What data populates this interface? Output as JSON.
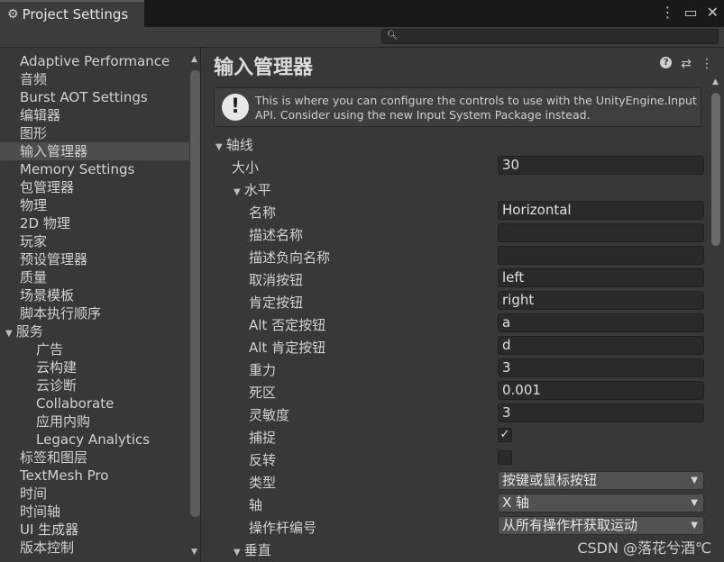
{
  "window": {
    "tab_title": "Project Settings",
    "tab_icon": "gear-icon",
    "controls": [
      "kebab-menu-icon",
      "maximize-icon",
      "close-icon"
    ]
  },
  "search": {
    "value": "",
    "icon": "search-icon"
  },
  "sidebar": {
    "items": [
      {
        "label": "Adaptive Performance",
        "depth": 0
      },
      {
        "label": "音频",
        "depth": 0
      },
      {
        "label": "Burst AOT Settings",
        "depth": 0
      },
      {
        "label": "编辑器",
        "depth": 0
      },
      {
        "label": "图形",
        "depth": 0
      },
      {
        "label": "输入管理器",
        "depth": 0,
        "selected": true
      },
      {
        "label": "Memory Settings",
        "depth": 0
      },
      {
        "label": "包管理器",
        "depth": 0
      },
      {
        "label": "物理",
        "depth": 0
      },
      {
        "label": "2D 物理",
        "depth": 0
      },
      {
        "label": "玩家",
        "depth": 0
      },
      {
        "label": "预设管理器",
        "depth": 0
      },
      {
        "label": "质量",
        "depth": 0
      },
      {
        "label": "场景模板",
        "depth": 0
      },
      {
        "label": "脚本执行顺序",
        "depth": 0
      },
      {
        "label": "服务",
        "depth": 0,
        "expandable": true
      },
      {
        "label": "广告",
        "depth": 1
      },
      {
        "label": "云构建",
        "depth": 1
      },
      {
        "label": "云诊断",
        "depth": 1
      },
      {
        "label": "Collaborate",
        "depth": 1
      },
      {
        "label": "应用内购",
        "depth": 1
      },
      {
        "label": "Legacy Analytics",
        "depth": 1
      },
      {
        "label": "标签和图层",
        "depth": 0
      },
      {
        "label": "TextMesh Pro",
        "depth": 0
      },
      {
        "label": "时间",
        "depth": 0
      },
      {
        "label": "时间轴",
        "depth": 0
      },
      {
        "label": "UI 生成器",
        "depth": 0
      },
      {
        "label": "版本控制",
        "depth": 0
      }
    ]
  },
  "main": {
    "title": "输入管理器",
    "header_icons": [
      "help-icon",
      "presets-icon",
      "kebab-menu-icon"
    ],
    "helpbox": "This is where you can configure the controls to use with the UnityEngine.Input API. Consider using the new Input System Package instead.",
    "axes_label": "轴线",
    "size_label": "大小",
    "size_value": "30",
    "horizontal": {
      "label": "水平",
      "fields": {
        "name": {
          "label": "名称",
          "value": "Horizontal"
        },
        "desc_name": {
          "label": "描述名称",
          "value": ""
        },
        "desc_neg_name": {
          "label": "描述负向名称",
          "value": ""
        },
        "neg_button": {
          "label": "取消按钮",
          "value": "left"
        },
        "pos_button": {
          "label": "肯定按钮",
          "value": "right"
        },
        "alt_neg_button": {
          "label": "Alt 否定按钮",
          "value": "a"
        },
        "alt_pos_button": {
          "label": "Alt 肯定按钮",
          "value": "d"
        },
        "gravity": {
          "label": "重力",
          "value": "3"
        },
        "dead": {
          "label": "死区",
          "value": "0.001"
        },
        "sensitivity": {
          "label": "灵敏度",
          "value": "3"
        },
        "snap": {
          "label": "捕捉",
          "checked": true,
          "mark": "✓"
        },
        "invert": {
          "label": "反转",
          "checked": false
        },
        "type": {
          "label": "类型",
          "value": "按键或鼠标按钮"
        },
        "axis": {
          "label": "轴",
          "value": "X 轴"
        },
        "joy_num": {
          "label": "操作杆编号",
          "value": "从所有操作杆获取运动"
        }
      }
    },
    "vertical_label": "垂直"
  },
  "watermark": "CSDN @落花兮酒℃"
}
